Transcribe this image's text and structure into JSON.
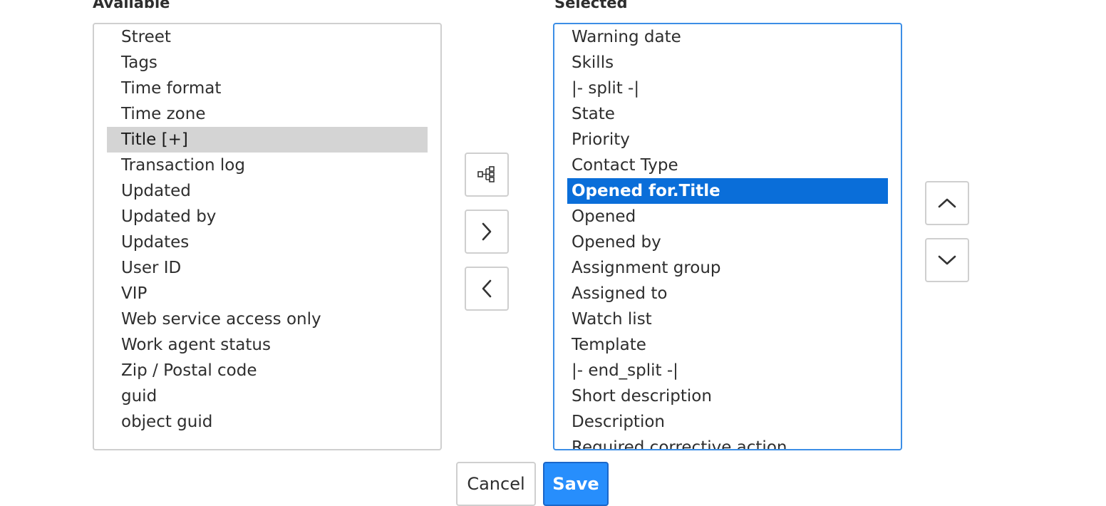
{
  "available": {
    "label": "Available",
    "items": [
      "Street",
      "Tags",
      "Time format",
      "Time zone",
      "Title [+]",
      "Transaction log",
      "Updated",
      "Updated by",
      "Updates",
      "User ID",
      "VIP",
      "Web service access only",
      "Work agent status",
      "Zip / Postal code",
      "guid",
      "object guid"
    ],
    "highlighted_index": 4
  },
  "selected": {
    "label": "Selected",
    "items": [
      "Warning date",
      "Skills",
      "|- split -|",
      "State",
      "Priority",
      "Contact Type",
      "Opened for.Title",
      "Opened",
      "Opened by",
      "Assignment group",
      "Assigned to",
      "Watch list",
      "Template",
      "|- end_split -|",
      "Short description",
      "Description",
      "Required corrective action"
    ],
    "selected_index": 6
  },
  "controls": {
    "tree_icon": "tree-hierarchy-icon",
    "add_icon": "chevron-right-icon",
    "remove_icon": "chevron-left-icon",
    "move_up_icon": "chevron-up-icon",
    "move_down_icon": "chevron-down-icon"
  },
  "footer": {
    "cancel_label": "Cancel",
    "save_label": "Save"
  },
  "colors": {
    "selection": "#0a6ed9",
    "highlight": "#d4d4d4",
    "primary_button": "#278efc",
    "focus_border": "#3c8ee6"
  }
}
